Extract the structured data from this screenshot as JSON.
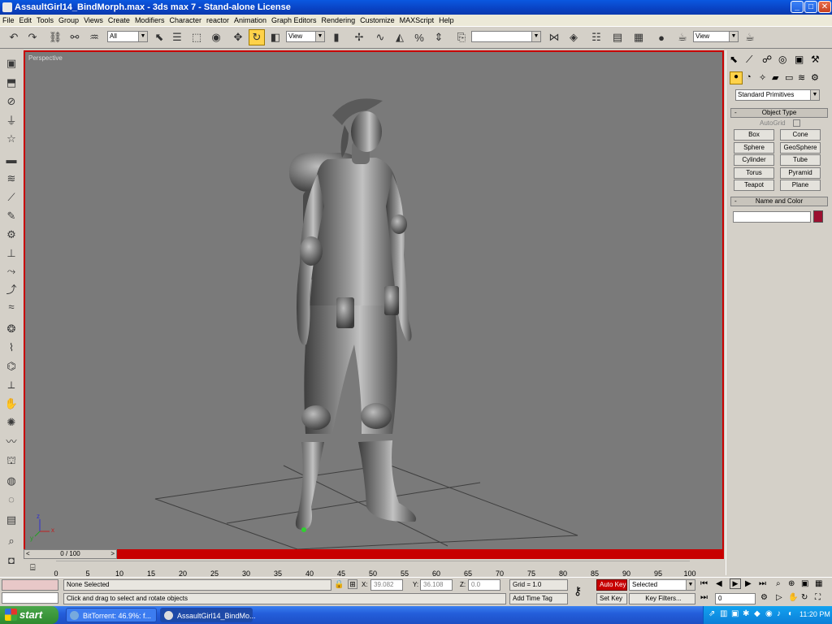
{
  "window": {
    "title": "AssaultGirl14_BindMorph.max - 3ds max 7 - Stand-alone License",
    "min_label": "_",
    "max_label": "□",
    "close_label": "✕"
  },
  "menu": [
    "File",
    "Edit",
    "Tools",
    "Group",
    "Views",
    "Create",
    "Modifiers",
    "Character",
    "reactor",
    "Animation",
    "Graph Editors",
    "Rendering",
    "Customize",
    "MAXScript",
    "Help"
  ],
  "toolbar": {
    "selection_filter": "All",
    "ref_coord": "View",
    "named_selection": "",
    "render_view": "View"
  },
  "viewport": {
    "label": "Perspective",
    "axis_x": "x",
    "axis_y": "y",
    "axis_z": "z"
  },
  "timeline": {
    "slider_label": "0 / 100",
    "ticks": [
      "0",
      "5",
      "10",
      "15",
      "20",
      "25",
      "30",
      "35",
      "40",
      "45",
      "50",
      "55",
      "60",
      "65",
      "70",
      "75",
      "80",
      "85",
      "90",
      "95",
      "100"
    ]
  },
  "command_panel": {
    "category_dropdown": "Standard Primitives",
    "object_type_header": "Object Type",
    "autogrid_label": "AutoGrid",
    "buttons": [
      "Box",
      "Cone",
      "Sphere",
      "GeoSphere",
      "Cylinder",
      "Tube",
      "Torus",
      "Pyramid",
      "Teapot",
      "Plane"
    ],
    "name_color_header": "Name and Color",
    "name_value": "",
    "object_color": "#9c1030",
    "collapse_symbol": "-"
  },
  "status": {
    "selection_text": "None Selected",
    "prompt_text": "Click and drag to select and rotate objects",
    "x_label": "X:",
    "x_value": "39.082",
    "y_label": "Y:",
    "y_value": "36.108",
    "z_label": "Z:",
    "z_value": "0.0",
    "grid_text": "Grid = 1.0",
    "add_time_tag": "Add Time Tag",
    "auto_key": "Auto Key",
    "set_key": "Set Key",
    "key_mode_dropdown": "Selected",
    "key_filters": "Key Filters...",
    "current_frame": "0"
  },
  "taskbar": {
    "start_label": "start",
    "tasks": [
      "BitTorrent: 46.9%: f...",
      "AssaultGirl14_BindMo..."
    ],
    "clock": "11:20 PM"
  },
  "colors": {
    "viewport_bg": "#7a7a7a",
    "active_border": "#c80000",
    "auto_key_bg": "#c80000",
    "title_bar": "#0a48d0"
  }
}
